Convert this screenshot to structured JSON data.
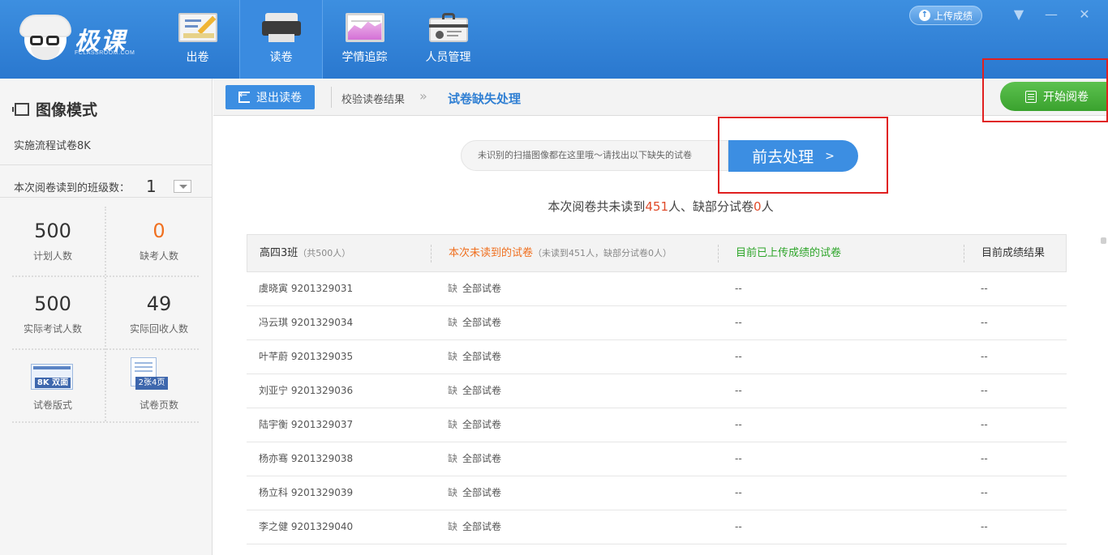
{
  "app": {
    "brand": "极课",
    "brand_sub": "FCLASSROOM.COM"
  },
  "nav": {
    "items": [
      {
        "label": "出卷",
        "icon": "exam-paper-icon"
      },
      {
        "label": "读卷",
        "icon": "scanner-icon",
        "active": true
      },
      {
        "label": "学情追踪",
        "icon": "chart-monitor-icon"
      },
      {
        "label": "人员管理",
        "icon": "id-card-icon"
      }
    ]
  },
  "header": {
    "upload_label": "上传成绩"
  },
  "sidebar": {
    "mode_title": "图像模式",
    "exam_name": "实施流程试卷8K",
    "class_count_label": "本次阅卷读到的班级数：",
    "class_count_value": "1",
    "stats": [
      {
        "value": "500",
        "label": "计划人数"
      },
      {
        "value": "0",
        "label": "缺考人数"
      },
      {
        "value": "500",
        "label": "实际考试人数"
      },
      {
        "value": "49",
        "label": "实际回收人数"
      }
    ],
    "format_badge": "8K 双面",
    "format_label": "试卷版式",
    "pages_badge": "2张4页",
    "pages_label": "试卷页数"
  },
  "toolbar": {
    "exit_label": "退出读卷",
    "crumb_prev": "校验读卷结果",
    "crumb_current": "试卷缺失处理",
    "start_label": "开始阅卷"
  },
  "notice": {
    "text": "未识别的扫描图像都在这里哦～请找出以下缺失的试卷",
    "go_label": "前去处理"
  },
  "summary": {
    "prefix": "本次阅卷共未读到",
    "missing_count": "451",
    "mid": "人、缺部分试卷",
    "partial_count": "0",
    "suffix": "人"
  },
  "table": {
    "class_name": "高四3班",
    "class_total": "（共500人）",
    "col_missing": "本次未读到的试卷",
    "col_missing_detail": "（未读到451人，缺部分试卷0人）",
    "col_uploaded": "目前已上传成绩的试卷",
    "col_result": "目前成绩结果",
    "missing_tag": "缺",
    "rows": [
      {
        "name": "虞晓寅",
        "id": "9201329031",
        "missing": "全部试卷",
        "uploaded": "--",
        "result": "--"
      },
      {
        "name": "冯云琪",
        "id": "9201329034",
        "missing": "全部试卷",
        "uploaded": "--",
        "result": "--"
      },
      {
        "name": "叶芊蔚",
        "id": "9201329035",
        "missing": "全部试卷",
        "uploaded": "--",
        "result": "--"
      },
      {
        "name": "刘亚宁",
        "id": "9201329036",
        "missing": "全部试卷",
        "uploaded": "--",
        "result": "--"
      },
      {
        "name": "陆宇衡",
        "id": "9201329037",
        "missing": "全部试卷",
        "uploaded": "--",
        "result": "--"
      },
      {
        "name": "杨亦骞",
        "id": "9201329038",
        "missing": "全部试卷",
        "uploaded": "--",
        "result": "--"
      },
      {
        "name": "杨立科",
        "id": "9201329039",
        "missing": "全部试卷",
        "uploaded": "--",
        "result": "--"
      },
      {
        "name": "李之健",
        "id": "9201329040",
        "missing": "全部试卷",
        "uploaded": "--",
        "result": "--"
      }
    ]
  },
  "colors": {
    "header_blue": "#2a78cf",
    "accent_blue": "#3c8ee2",
    "green": "#3aa22e",
    "orange": "#f07020",
    "highlight_red": "#e02020"
  }
}
